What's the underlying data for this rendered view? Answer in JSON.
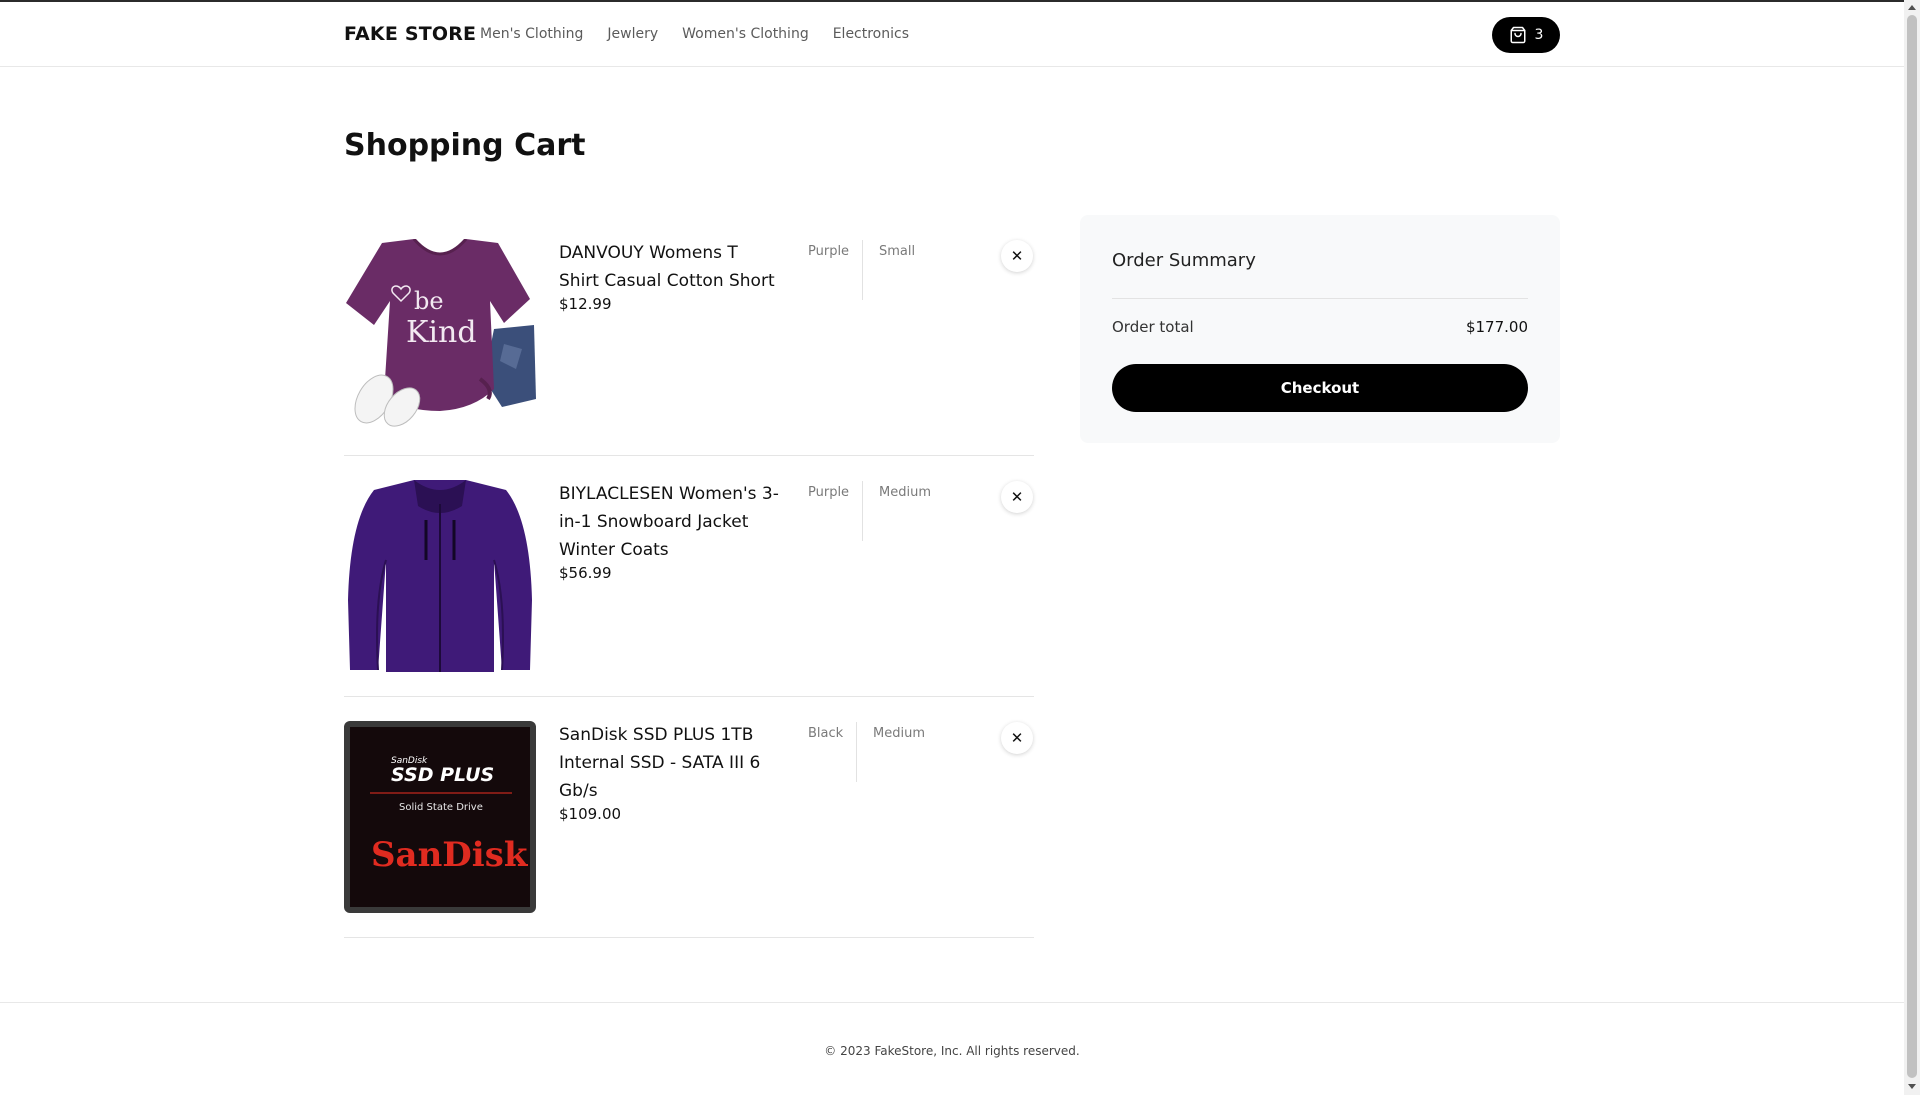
{
  "header": {
    "logo": "FAKE STORE",
    "nav": [
      "Men's Clothing",
      "Jewlery",
      "Women's Clothing",
      "Electronics"
    ],
    "cart_count": "3"
  },
  "page_title": "Shopping Cart",
  "cart": {
    "items": [
      {
        "name": "DANVOUY Womens T Shirt Casual Cotton Short",
        "price": "$12.99",
        "color": "Purple",
        "size": "Small"
      },
      {
        "name": "BIYLACLESEN Women's 3-in-1 Snowboard Jacket Winter Coats",
        "price": "$56.99",
        "color": "Purple",
        "size": "Medium"
      },
      {
        "name": "SanDisk SSD PLUS 1TB Internal SSD - SATA III 6 Gb/s",
        "price": "$109.00",
        "color": "Black",
        "size": "Medium"
      }
    ],
    "remove_symbol": "✕"
  },
  "summary": {
    "title": "Order Summary",
    "total_label": "Order total",
    "total_value": "$177.00",
    "checkout_label": "Checkout"
  },
  "product_images": {
    "tshirt_text_1": "be",
    "tshirt_text_2": "Kind",
    "ssd_brand_small": "SanDisk",
    "ssd_title": "SSD PLUS",
    "ssd_subtitle": "Solid State Drive",
    "ssd_logo": "SanDisk"
  },
  "footer": {
    "copyright": "© 2023 FakeStore, Inc. All rights reserved."
  },
  "colors": {
    "accent": "#000000",
    "summary_bg": "#f8f9fa",
    "ssd_red": "#e02b20"
  }
}
